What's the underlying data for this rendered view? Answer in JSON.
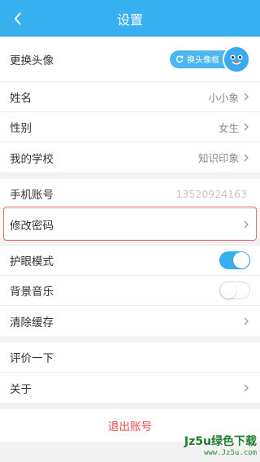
{
  "header": {
    "title": "设置"
  },
  "avatar_row": {
    "label": "更换头像",
    "button_label": "换头像框"
  },
  "profile": {
    "name": {
      "label": "姓名",
      "value": "小小象"
    },
    "gender": {
      "label": "性别",
      "value": "女生"
    },
    "school": {
      "label": "我的学校",
      "value": "知识印象"
    }
  },
  "account": {
    "phone": {
      "label": "手机账号",
      "value": "13520924163"
    },
    "password": {
      "label": "修改密码"
    }
  },
  "prefs": {
    "eye_mode": {
      "label": "护眼模式",
      "on": true
    },
    "bg_music": {
      "label": "背景音乐",
      "on": false
    },
    "clear_cache": {
      "label": "清除缓存"
    }
  },
  "about": {
    "rate": {
      "label": "评价一下"
    },
    "about": {
      "label": "关于"
    }
  },
  "logout": {
    "label": "退出账号"
  },
  "watermark": {
    "main": "Jz5u绿色下载",
    "sub": "www.Jz5u.com"
  },
  "colors": {
    "accent": "#38b0f0",
    "logout": "#e94848",
    "highlight": "#e56b6b"
  }
}
